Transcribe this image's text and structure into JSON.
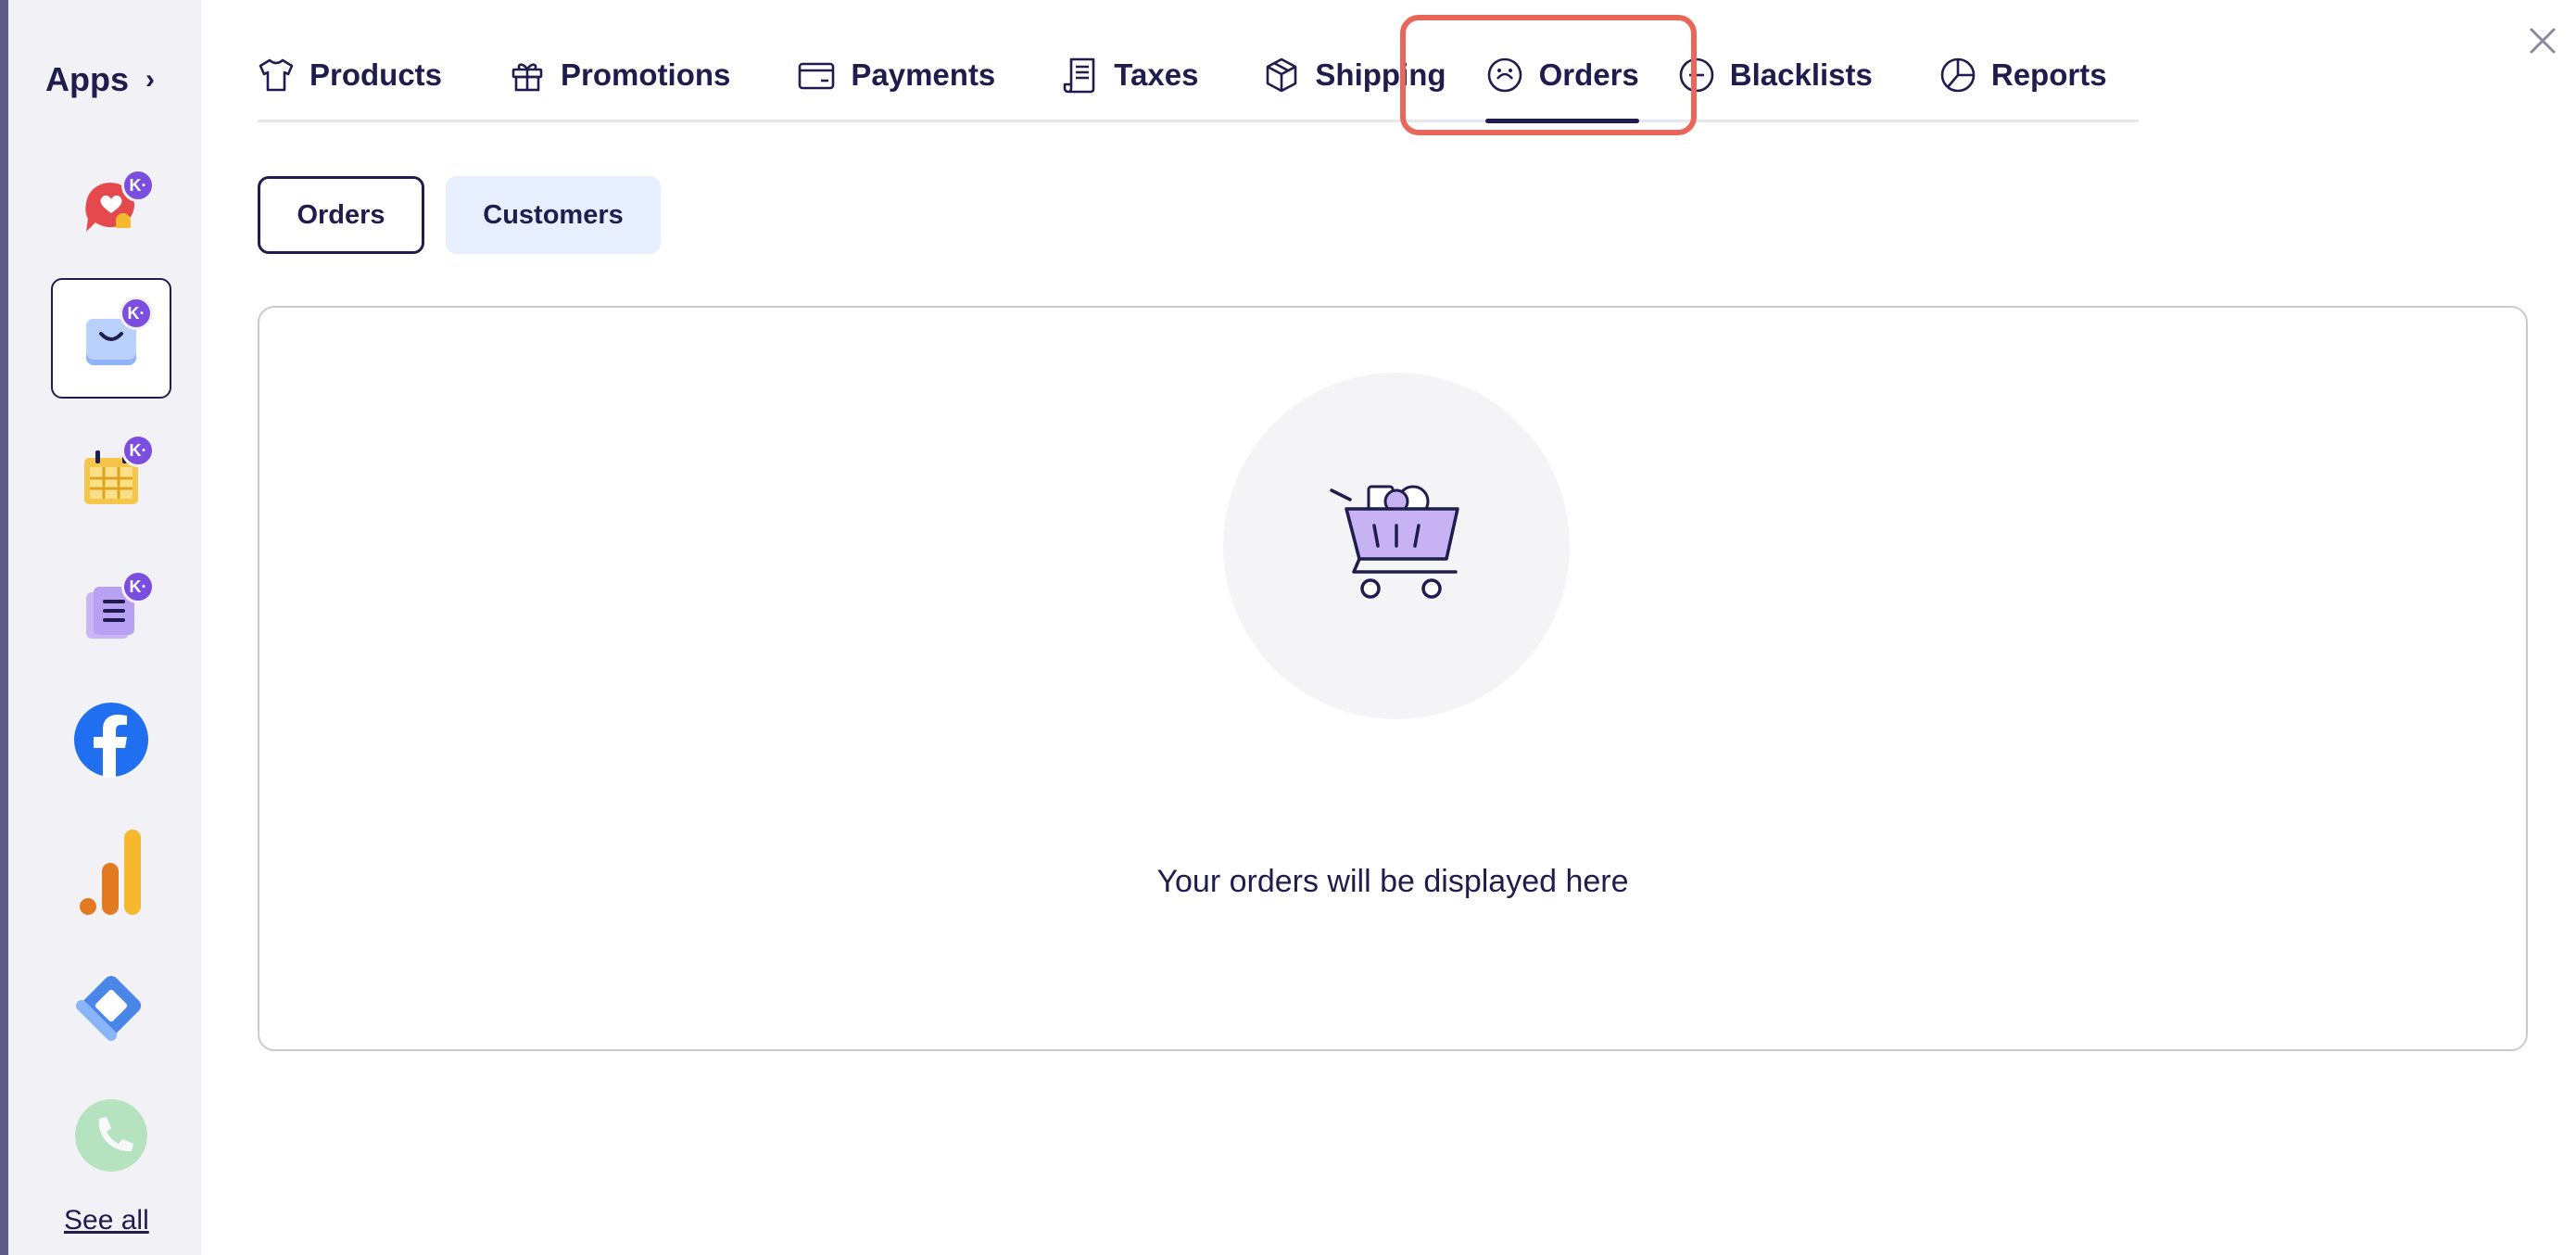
{
  "sidebar": {
    "title": "Apps",
    "see_all": "See all",
    "badge_label": "K·",
    "apps": [
      {
        "name": "chat-heart-app"
      },
      {
        "name": "shop-app"
      },
      {
        "name": "calendar-app"
      },
      {
        "name": "forms-app"
      },
      {
        "name": "facebook-app"
      },
      {
        "name": "analytics-app"
      },
      {
        "name": "tag-manager-app"
      },
      {
        "name": "phone-app"
      }
    ]
  },
  "tabs": {
    "items": [
      {
        "label": "Products"
      },
      {
        "label": "Promotions"
      },
      {
        "label": "Payments"
      },
      {
        "label": "Taxes"
      },
      {
        "label": "Shipping"
      },
      {
        "label": "Orders"
      },
      {
        "label": "Blacklists"
      },
      {
        "label": "Reports"
      }
    ],
    "active": "Orders"
  },
  "subtabs": {
    "orders": "Orders",
    "customers": "Customers"
  },
  "empty_state": {
    "message": "Your orders will be displayed here",
    "icon": "shopping-cart-icon"
  },
  "colors": {
    "ink": "#1f1d4d",
    "highlight": "#e8675a",
    "badge": "#7b4ee0",
    "subtab_bg": "#e7efff"
  }
}
